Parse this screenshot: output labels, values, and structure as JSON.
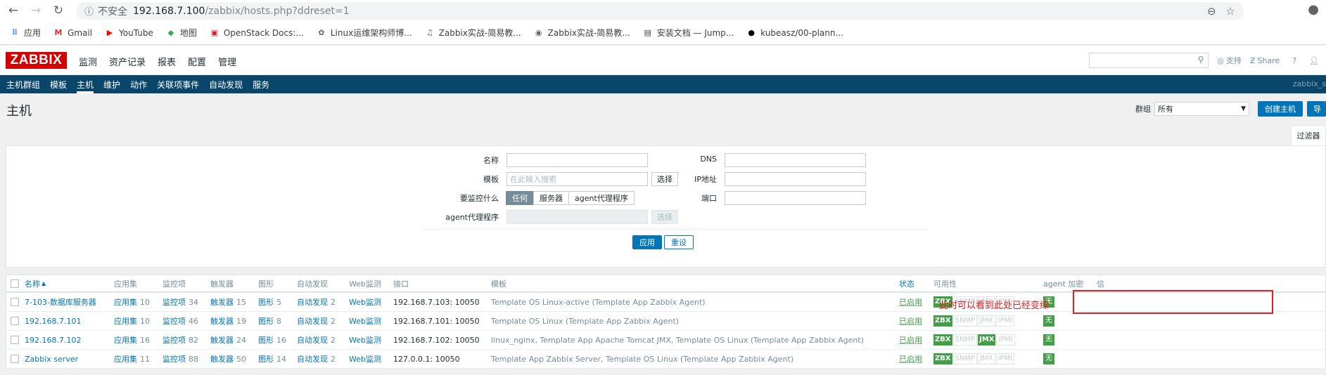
{
  "browser": {
    "insecure_label": "不安全",
    "url_host": "192.168.7.100",
    "url_path": "/zabbix/hosts.php?ddreset=1",
    "bookmarks": [
      {
        "label": "应用",
        "icon": "apps-grid-icon",
        "color": "#4285f4"
      },
      {
        "label": "Gmail",
        "icon": "gmail-icon",
        "color": "#d93025"
      },
      {
        "label": "YouTube",
        "icon": "youtube-icon",
        "color": "#ff0000"
      },
      {
        "label": "地图",
        "icon": "maps-icon",
        "color": "#34a853"
      },
      {
        "label": "OpenStack Docs:...",
        "icon": "openstack-icon",
        "color": "#da1a32"
      },
      {
        "label": "Linux运维架构师博...",
        "icon": "blog-icon",
        "color": "#5f6368"
      },
      {
        "label": "Zabbix实战-简易教...",
        "icon": "zabbix-bookmark-icon",
        "color": "#5f6368"
      },
      {
        "label": "Zabbix实战-简易教...",
        "icon": "globe-icon",
        "color": "#5f6368"
      },
      {
        "label": "安装文档 — Jump...",
        "icon": "doc-icon",
        "color": "#3c4043"
      },
      {
        "label": "kubeasz/00-plann...",
        "icon": "github-icon",
        "color": "#000000"
      }
    ]
  },
  "header": {
    "logo": "ZABBIX",
    "menu": [
      "监测",
      "资产记录",
      "报表",
      "配置",
      "管理"
    ],
    "support": "支持",
    "share": "Share",
    "help": "?",
    "user": "user-icon"
  },
  "submenu": {
    "items": [
      "主机群组",
      "模板",
      "主机",
      "维护",
      "动作",
      "关联项事件",
      "自动发现",
      "服务"
    ],
    "active_index": 2,
    "user_id": "zabbix_s"
  },
  "page": {
    "title": "主机",
    "group_label": "群组",
    "group_value": "所有",
    "create_button": "创建主机",
    "import_button": "导",
    "filter_tab": "过滤器"
  },
  "filter": {
    "name_label": "名称",
    "name_value": "",
    "template_label": "模板",
    "template_placeholder": "在此输入搜索",
    "select_label": "选择",
    "monitored_by_label": "要监控什么",
    "monitored_by_options": [
      "任何",
      "服务器",
      "agent代理程序"
    ],
    "proxy_label": "agent代理程序",
    "proxy_select_label": "选择",
    "dns_label": "DNS",
    "ip_label": "IP地址",
    "port_label": "端口",
    "apply": "应用",
    "reset": "重设"
  },
  "table": {
    "headers": {
      "name": "名称",
      "applications": "应用集",
      "items": "监控项",
      "triggers": "触发器",
      "graphs": "图形",
      "discovery": "自动发现",
      "web": "Web监测",
      "interface": "接口",
      "templates": "模板",
      "status": "状态",
      "availability": "可用性",
      "encryption": "agent 加密",
      "info": "信"
    },
    "rows": [
      {
        "name": "7-103-数据库服务器",
        "applications_label": "应用集",
        "applications": "10",
        "items_label": "监控项",
        "items": "34",
        "triggers_label": "触发器",
        "triggers": "15",
        "graphs_label": "图形",
        "graphs": "5",
        "discovery_label": "自动发现",
        "discovery": "2",
        "web": "Web监测",
        "interface": "192.168.7.103: 10050",
        "templates": "Template OS Linux-active (Template App Zabbix Agent)",
        "status": "已启用",
        "zbx": "ZBX",
        "snmp": "SNMP",
        "jmx": "JMX",
        "ipmi": "IPMI",
        "jmx_on": false,
        "encryption": "无"
      },
      {
        "name": "192.168.7.101",
        "applications_label": "应用集",
        "applications": "10",
        "items_label": "监控项",
        "items": "46",
        "triggers_label": "触发器",
        "triggers": "19",
        "graphs_label": "图形",
        "graphs": "8",
        "discovery_label": "自动发现",
        "discovery": "2",
        "web": "Web监测",
        "interface": "192.168.7.101: 10050",
        "templates": "Template OS Linux (Template App Zabbix Agent)",
        "status": "已启用",
        "zbx": "ZBX",
        "snmp": "SNMP",
        "jmx": "JMX",
        "ipmi": "IPMI",
        "jmx_on": false,
        "encryption": "无"
      },
      {
        "name": "192.168.7.102",
        "applications_label": "应用集",
        "applications": "16",
        "items_label": "监控项",
        "items": "82",
        "triggers_label": "触发器",
        "triggers": "24",
        "graphs_label": "图形",
        "graphs": "16",
        "discovery_label": "自动发现",
        "discovery": "2",
        "web": "Web监测",
        "interface": "192.168.7.102: 10050",
        "templates": "linux_nginx, Template App Apache Tomcat JMX, Template OS Linux (Template App Zabbix Agent)",
        "status": "已启用",
        "zbx": "ZBX",
        "snmp": "SNMP",
        "jmx": "JMX",
        "ipmi": "IPMI",
        "jmx_on": true,
        "encryption": "无"
      },
      {
        "name": "Zabbix server",
        "applications_label": "应用集",
        "applications": "11",
        "items_label": "监控项",
        "items": "88",
        "triggers_label": "触发器",
        "triggers": "50",
        "graphs_label": "图形",
        "graphs": "14",
        "discovery_label": "自动发现",
        "discovery": "2",
        "web": "Web监测",
        "interface": "127.0.0.1: 10050",
        "templates": "Template App Zabbix Server, Template OS Linux (Template App Zabbix Agent)",
        "status": "已启用",
        "zbx": "ZBX",
        "snmp": "SNMP",
        "jmx": "JMX",
        "ipmi": "IPMI",
        "jmx_on": false,
        "encryption": "无"
      }
    ]
  },
  "annotation": {
    "text": "此时可以看到此处已经变绿",
    "color": "#e02020"
  }
}
